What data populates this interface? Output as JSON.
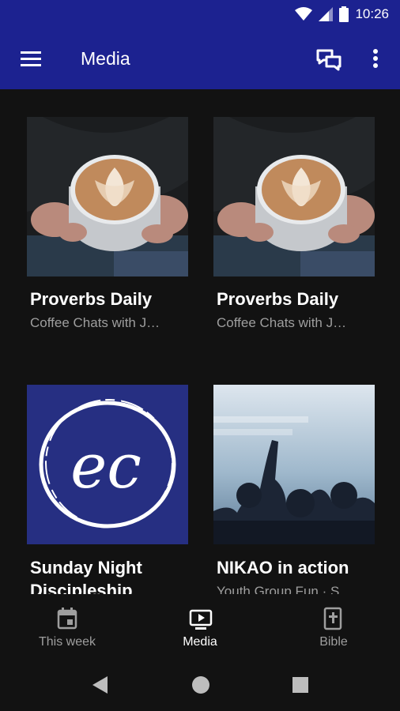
{
  "status_bar": {
    "time": "10:26"
  },
  "app_bar": {
    "title": "Media",
    "menu_icon": "hamburger-menu-icon",
    "chat_icon": "chat-icon",
    "more_icon": "more-vertical-icon"
  },
  "cards": [
    {
      "title": "Proverbs Daily",
      "subtitle": "Coffee Chats with J…",
      "image": "coffee-latte"
    },
    {
      "title": "Proverbs Daily",
      "subtitle": "Coffee Chats with J…",
      "image": "coffee-latte"
    },
    {
      "title": "Sunday Night",
      "title_line2": "Discipleship",
      "image": "ec-logo",
      "logo_text": "ec"
    },
    {
      "title": "NIKAO in action",
      "subtitle": "Youth Group Fun · S",
      "image": "concert-crowd"
    }
  ],
  "bottom_nav": {
    "items": [
      {
        "label": "This week",
        "icon": "calendar-icon",
        "active": false
      },
      {
        "label": "Media",
        "icon": "tv-play-icon",
        "active": true
      },
      {
        "label": "Bible",
        "icon": "bible-icon",
        "active": false
      }
    ]
  },
  "colors": {
    "primary": "#1c2290",
    "background": "#121212",
    "inactive": "#9e9e9e",
    "ec_background": "#262f82"
  }
}
